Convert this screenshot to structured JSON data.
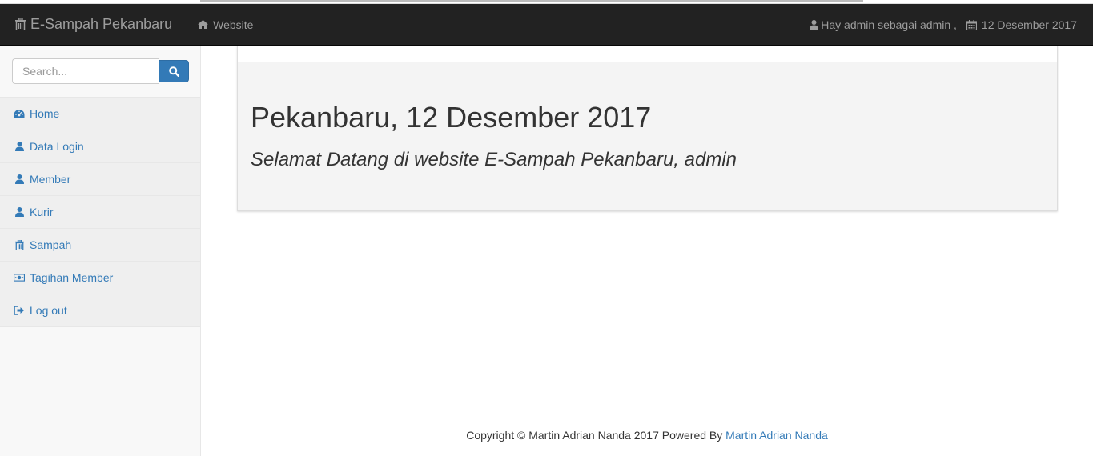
{
  "navbar": {
    "brand": "E-Sampah Pekanbaru",
    "brand_icon": "trash-icon",
    "website_link": "Website",
    "website_icon": "home-icon",
    "user_text": "Hay admin sebagai admin ,",
    "user_icon": "user-icon",
    "date_text": "12 Desember 2017",
    "date_icon": "calendar-icon"
  },
  "sidebar": {
    "search": {
      "placeholder": "Search...",
      "value": ""
    },
    "search_icon": "search-icon",
    "items": [
      {
        "label": "Home",
        "icon": "dashboard-icon"
      },
      {
        "label": "Data Login",
        "icon": "user-icon"
      },
      {
        "label": "Member",
        "icon": "user-icon"
      },
      {
        "label": "Kurir",
        "icon": "user-icon"
      },
      {
        "label": "Sampah",
        "icon": "trash-icon"
      },
      {
        "label": "Tagihan Member",
        "icon": "money-icon"
      },
      {
        "label": "Log out",
        "icon": "sign-out-icon"
      }
    ]
  },
  "main": {
    "heading": "Pekanbaru, 12 Desember 2017",
    "subheading": "Selamat Datang di website E-Sampah Pekanbaru, admin"
  },
  "footer": {
    "text": "Copyright © Martin Adrian Nanda 2017 Powered By",
    "link": "Martin Adrian Nanda"
  },
  "colors": {
    "navbar_bg": "#222222",
    "navbar_text": "#9d9d9d",
    "link": "#337ab7",
    "sidebar_bg": "#f8f8f8",
    "jumbotron_bg": "#f4f4f4"
  }
}
